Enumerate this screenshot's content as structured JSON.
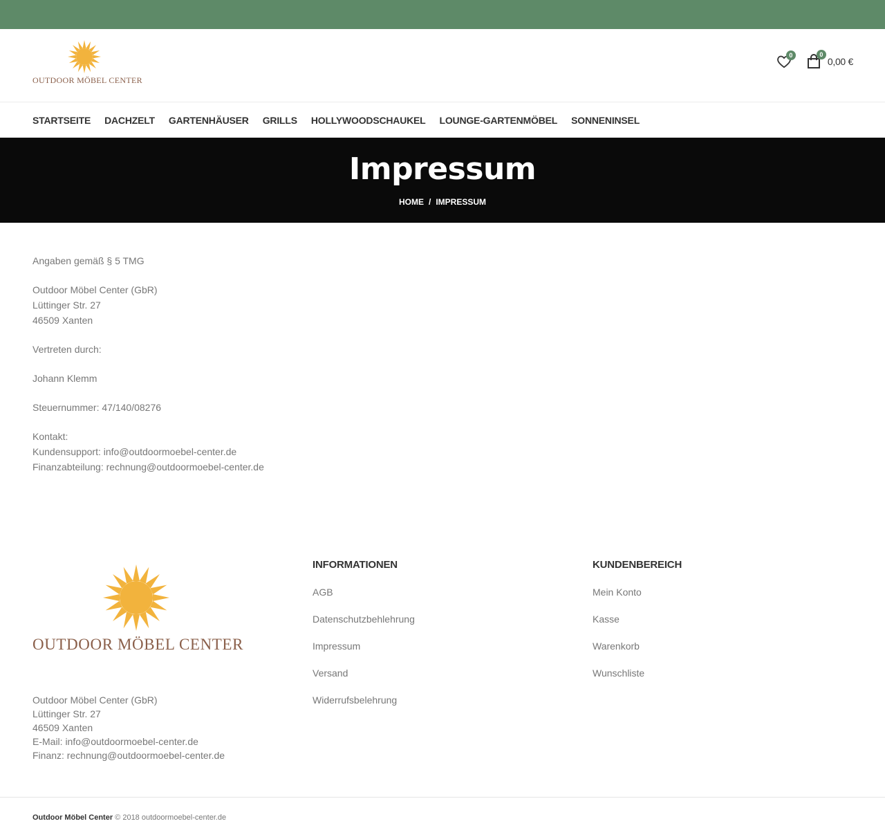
{
  "brand": {
    "logo_text": "OUTDOOR MÖBEL CENTER",
    "accent_color": "#5e8a68",
    "logo_color": "#f2b33d"
  },
  "header": {
    "wishlist_count": "0",
    "cart_count": "0",
    "cart_total": "0,00 €"
  },
  "nav": {
    "items": [
      "STARTSEITE",
      "DACHZELT",
      "GARTENHÄUSER",
      "GRILLS",
      "HOLLYWOODSCHAUKEL",
      "LOUNGE-GARTENMÖBEL",
      "SONNENINSEL"
    ]
  },
  "hero": {
    "title": "Impressum",
    "breadcrumb_home": "HOME",
    "breadcrumb_sep": "/",
    "breadcrumb_current": "IMPRESSUM"
  },
  "content": {
    "tmg": "Angaben gemäß § 5 TMG",
    "company": "Outdoor Möbel Center (GbR)",
    "street": "Lüttinger Str. 27",
    "city": "46509 Xanten",
    "represented_label": "Vertreten durch:",
    "representative": "Johann Klemm",
    "tax": "Steuernummer: 47/140/08276",
    "contact_label": "Kontakt:",
    "support": "Kundensupport: info@outdoormoebel-center.de",
    "finance": "Finanzabteilung: rechnung@outdoormoebel-center.de"
  },
  "footer": {
    "logo_text": "OUTDOOR MÖBEL CENTER",
    "address": {
      "company": "Outdoor Möbel Center (GbR)",
      "street": "Lüttinger Str. 27",
      "city": "46509 Xanten",
      "email": "E-Mail: info@outdoormoebel-center.de",
      "finance": "Finanz: rechnung@outdoormoebel-center.de"
    },
    "info": {
      "title": "INFORMATIONEN",
      "links": [
        "AGB",
        "Datenschutzbehlehrung",
        "Impressum",
        "Versand",
        "Widerrufsbelehrung"
      ]
    },
    "account": {
      "title": "KUNDENBEREICH",
      "links": [
        "Mein Konto",
        "Kasse",
        "Warenkorb",
        "Wunschliste"
      ]
    }
  },
  "copyright": {
    "brand": "Outdoor Möbel Center",
    "text": "© 2018 outdoormoebel-center.de"
  }
}
